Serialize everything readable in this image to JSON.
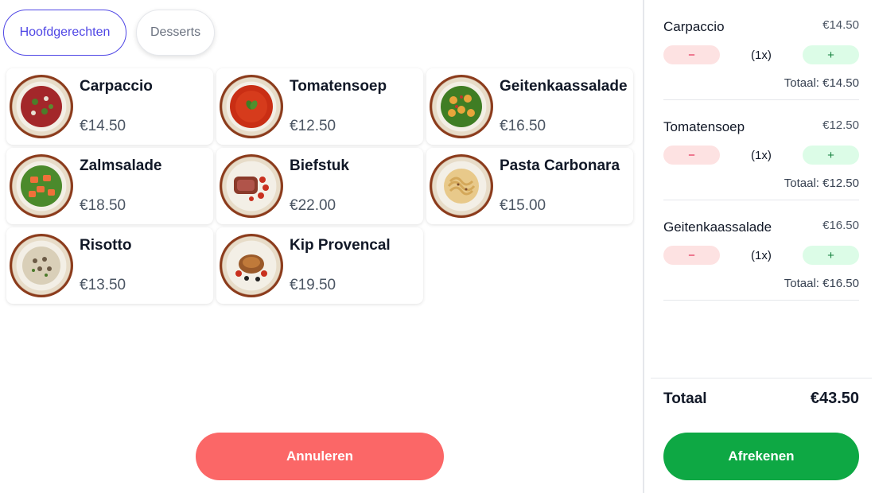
{
  "tabs": [
    {
      "label": "Hoofdgerechten",
      "active": true
    },
    {
      "label": "Desserts",
      "active": false
    }
  ],
  "menu": [
    {
      "name": "Carpaccio",
      "price": "€14.50",
      "image": "carpaccio-plate"
    },
    {
      "name": "Tomatensoep",
      "price": "€12.50",
      "image": "tomato-soup-bowl"
    },
    {
      "name": "Geitenkaassalade",
      "price": "€16.50",
      "image": "goat-cheese-salad-plate"
    },
    {
      "name": "Zalmsalade",
      "price": "€18.50",
      "image": "salmon-salad-plate"
    },
    {
      "name": "Biefstuk",
      "price": "€22.00",
      "image": "steak-plate"
    },
    {
      "name": "Pasta Carbonara",
      "price": "€15.00",
      "image": "pasta-plate"
    },
    {
      "name": "Risotto",
      "price": "€13.50",
      "image": "risotto-plate"
    },
    {
      "name": "Kip Provencal",
      "price": "€19.50",
      "image": "chicken-plate"
    }
  ],
  "actions": {
    "cancel_label": "Annuleren",
    "checkout_label": "Afrekenen"
  },
  "order": {
    "items": [
      {
        "name": "Carpaccio",
        "price": "€14.50",
        "minus": "−",
        "qty": "(1x)",
        "plus": "+",
        "total": "Totaal: €14.50"
      },
      {
        "name": "Tomatensoep",
        "price": "€12.50",
        "minus": "−",
        "qty": "(1x)",
        "plus": "+",
        "total": "Totaal: €12.50"
      },
      {
        "name": "Geitenkaassalade",
        "price": "€16.50",
        "minus": "−",
        "qty": "(1x)",
        "plus": "+",
        "total": "Totaal: €16.50"
      }
    ],
    "total_label": "Totaal",
    "total_value": "€43.50"
  },
  "colors": {
    "accent": "#4f46e5",
    "cancel": "#fb6767",
    "checkout": "#0ea844",
    "minus_bg": "#fde2e2",
    "plus_bg": "#dcfce7"
  }
}
